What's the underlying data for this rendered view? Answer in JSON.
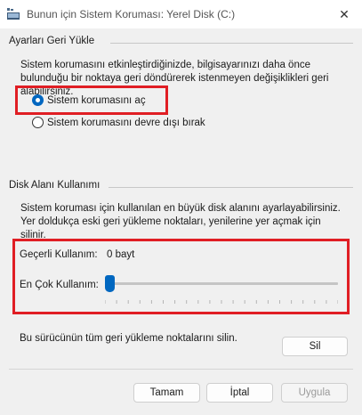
{
  "window": {
    "title": "Bunun için Sistem Koruması: Yerel Disk (C:)",
    "close_glyph": "✕"
  },
  "restore": {
    "group_title": "Ayarları Geri Yükle",
    "description": "Sistem korumasını etkinleştirdiğinizde, bilgisayarınızı daha önce bulunduğu bir noktaya geri döndürerek istenmeyen değişiklikleri geri alabilirsiniz.",
    "options": [
      {
        "label": "Sistem korumasını aç",
        "checked": true
      },
      {
        "label": "Sistem korumasını devre dışı bırak",
        "checked": false
      }
    ]
  },
  "disk": {
    "group_title": "Disk Alanı Kullanımı",
    "description": "Sistem koruması için kullanılan en büyük disk alanını ayarlayabilirsiniz. Yer doldukça eski geri yükleme noktaları, yenilerine yer açmak için silinir.",
    "current_usage_label": "Geçerli Kullanım:",
    "current_usage_value": "0 bayt",
    "max_usage_label": "En Çok Kullanım:",
    "max_usage_fraction": 0,
    "delete_text": "Bu sürücünün tüm geri yükleme noktalarını silin.",
    "delete_button": "Sil"
  },
  "footer": {
    "ok": "Tamam",
    "cancel": "İptal",
    "apply": "Uygula"
  },
  "colors": {
    "accent": "#0067c0",
    "highlight": "#e01e24"
  }
}
